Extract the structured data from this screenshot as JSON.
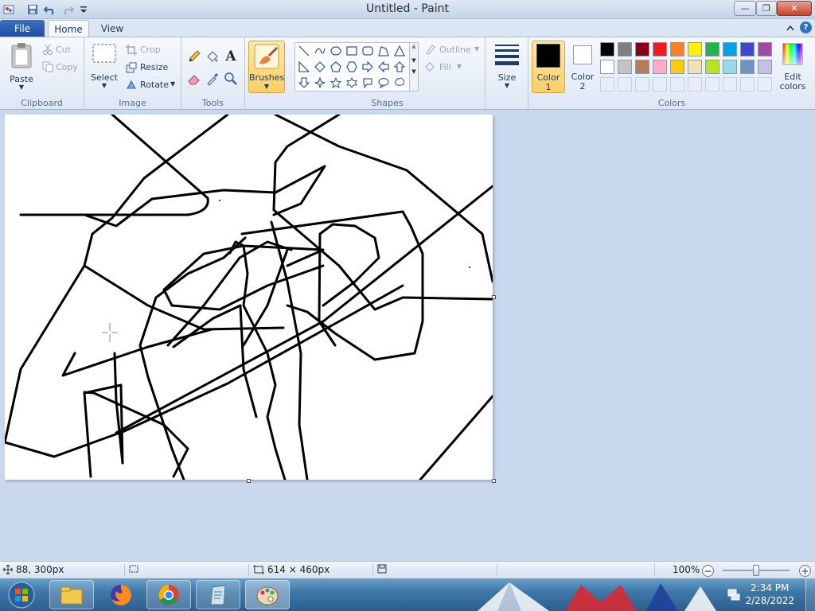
{
  "window": {
    "title": "Untitled - Paint",
    "minimize_glyph": "—",
    "restore_glyph": "❐",
    "close_glyph": "✕"
  },
  "tabs": {
    "file": "File",
    "home": "Home",
    "view": "View"
  },
  "ribbon": {
    "clipboard": {
      "label": "Clipboard",
      "paste": "Paste",
      "cut": "Cut",
      "copy": "Copy"
    },
    "image": {
      "label": "Image",
      "select": "Select",
      "crop": "Crop",
      "resize": "Resize",
      "rotate": "Rotate"
    },
    "tools": {
      "label": "Tools",
      "text_glyph": "A"
    },
    "brushes": {
      "label": "Brushes"
    },
    "shapes": {
      "label": "Shapes",
      "outline": "Outline",
      "fill": "Fill"
    },
    "size": {
      "label": "Size"
    },
    "colors": {
      "label": "Colors",
      "color1": "Color",
      "color1_num": "1",
      "color2": "Color",
      "color2_num": "2",
      "edit_colors": "Edit",
      "edit_colors2": "colors",
      "color1_value": "#000000",
      "color2_value": "#ffffff",
      "palette": [
        "#000000",
        "#7f7f7f",
        "#880015",
        "#ed1c24",
        "#ff7f27",
        "#fff200",
        "#22b14c",
        "#00a2e8",
        "#3f48cc",
        "#a349a4",
        "#ffffff",
        "#c3c3c3",
        "#b97a57",
        "#ffaec9",
        "#ffc90e",
        "#efe4b0",
        "#b5e61d",
        "#99d9ea",
        "#7092be",
        "#c8bfe7"
      ]
    }
  },
  "status": {
    "cursor_pos": "88, 300px",
    "image_size": "614 × 460px",
    "zoom": "100%"
  },
  "taskbar": {
    "time": "2:34 PM",
    "date": "2/28/2022"
  }
}
